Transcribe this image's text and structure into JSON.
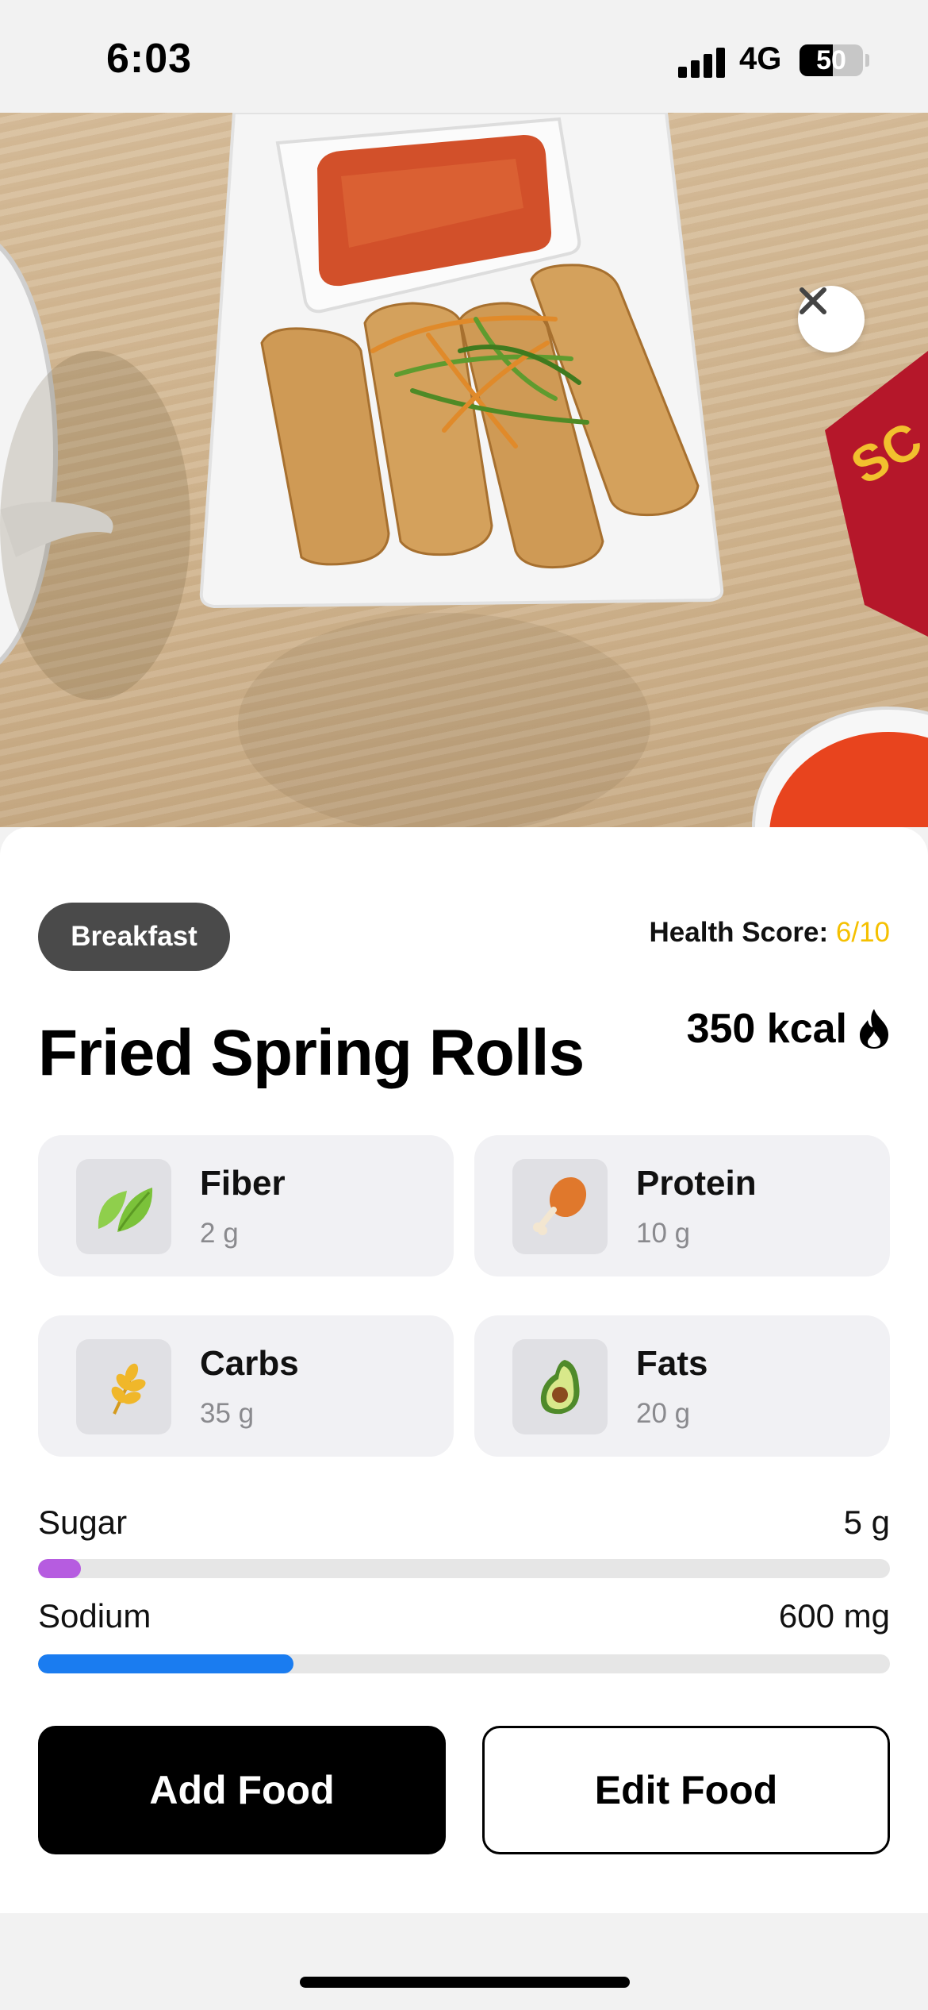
{
  "status_bar": {
    "time": "6:03",
    "network": "4G",
    "battery": "50"
  },
  "food": {
    "meal_type": "Breakfast",
    "health_score_label": "Health Score:",
    "health_score_value": "6/10",
    "name": "Fried Spring Rolls",
    "calories": "350 kcal"
  },
  "nutrients": [
    {
      "label": "Fiber",
      "value": "2 g",
      "icon": "leaf-icon"
    },
    {
      "label": "Protein",
      "value": "10 g",
      "icon": "drumstick-icon"
    },
    {
      "label": "Carbs",
      "value": "35 g",
      "icon": "wheat-icon"
    },
    {
      "label": "Fats",
      "value": "20 g",
      "icon": "avocado-icon"
    }
  ],
  "metrics": [
    {
      "label": "Sugar",
      "value": "5 g",
      "fill_fraction": 0.05,
      "color": "#b65ce0"
    },
    {
      "label": "Sodium",
      "value": "600 mg",
      "fill_fraction": 0.3,
      "color": "#1a7cf0"
    }
  ],
  "actions": {
    "add_label": "Add Food",
    "edit_label": "Edit Food"
  },
  "colors": {
    "health_score": "#f5c000",
    "pill_bg": "#4a4a4a"
  }
}
